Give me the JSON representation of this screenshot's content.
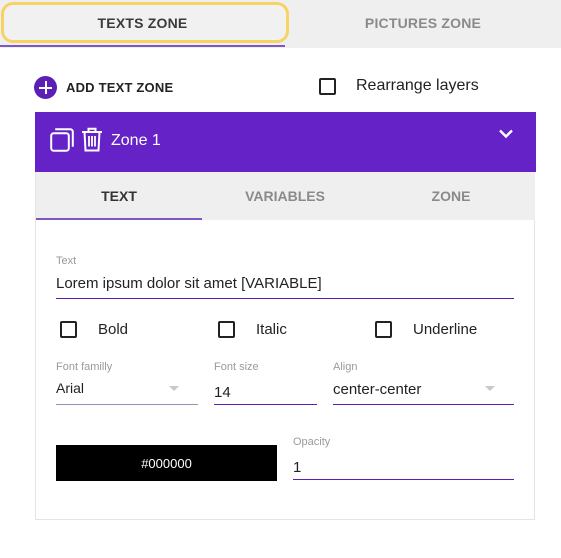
{
  "top_tabs": {
    "texts": "TEXTS ZONE",
    "pictures": "PICTURES ZONE"
  },
  "add_text_zone": "ADD TEXT ZONE",
  "rearrange_layers": "Rearrange layers",
  "zone": {
    "title": "Zone 1",
    "tabs": [
      "TEXT",
      "VARIABLES",
      "ZONE"
    ],
    "text_label": "Text",
    "text_value": "Lorem ipsum dolor sit amet [VARIABLE]",
    "bold": "Bold",
    "italic": "Italic",
    "underline": "Underline",
    "font_family_label": "Font familly",
    "font_family_value": "Arial",
    "font_size_label": "Font size",
    "font_size_value": "14",
    "align_label": "Align",
    "align_value": "center-center",
    "color_value": "#000000",
    "opacity_label": "Opacity",
    "opacity_value": "1"
  },
  "colors": {
    "accent": "#6522c6",
    "focus": "#f6d365",
    "tab_bg": "#efeff0"
  },
  "icons": [
    "add-circle-icon",
    "layers-icon",
    "trash-icon",
    "chevron-down-icon"
  ]
}
